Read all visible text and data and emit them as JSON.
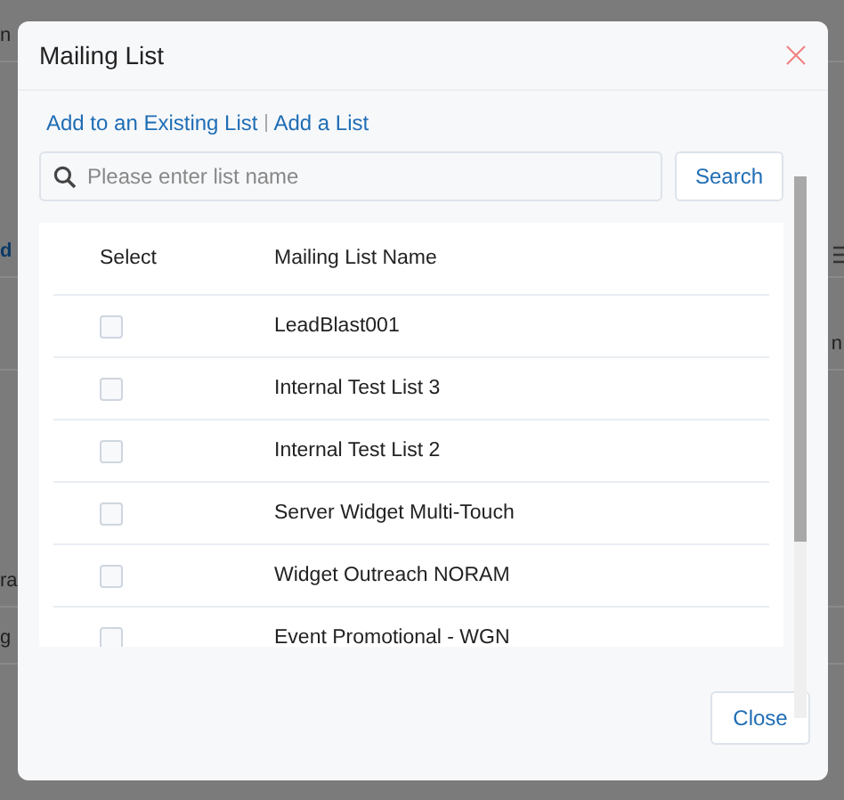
{
  "background": {
    "fragments": [
      "n",
      "d",
      "n",
      "ra",
      "g"
    ]
  },
  "dialog": {
    "title": "Mailing List",
    "links": [
      "Add to an Existing List",
      "Add a List"
    ],
    "search": {
      "placeholder": "Please enter list name",
      "button": "Search"
    },
    "table": {
      "columns": [
        "Select",
        "Mailing List Name"
      ],
      "rows": [
        {
          "checked": false,
          "name": "LeadBlast001"
        },
        {
          "checked": false,
          "name": "Internal Test List 3"
        },
        {
          "checked": false,
          "name": "Internal Test List 2"
        },
        {
          "checked": false,
          "name": "Server Widget Multi-Touch"
        },
        {
          "checked": false,
          "name": "Widget Outreach NORAM"
        },
        {
          "checked": false,
          "name": "Event Promotional - WGN"
        }
      ]
    },
    "buttons": [
      "Close"
    ]
  }
}
